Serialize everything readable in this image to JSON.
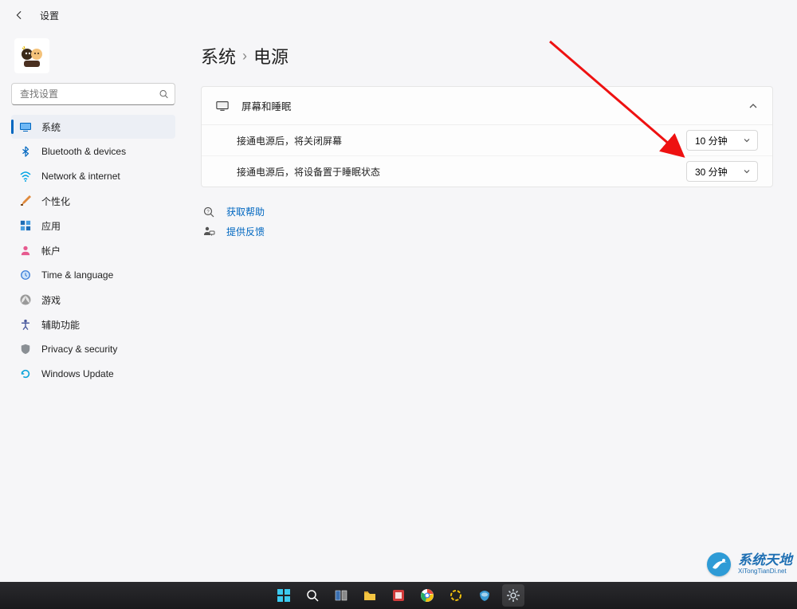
{
  "header": {
    "title": "设置"
  },
  "search": {
    "placeholder": "查找设置"
  },
  "nav": {
    "items": [
      {
        "label": "系统",
        "icon": "system",
        "color": "#0067c0"
      },
      {
        "label": "Bluetooth & devices",
        "icon": "bluetooth",
        "color": "#0067c0"
      },
      {
        "label": "Network & internet",
        "icon": "wifi",
        "color": "#00a4e4"
      },
      {
        "label": "个性化",
        "icon": "personalize",
        "color": "#e08a3c"
      },
      {
        "label": "应用",
        "icon": "apps",
        "color": "#1f6db5"
      },
      {
        "label": "帐户",
        "icon": "account",
        "color": "#e65a8f"
      },
      {
        "label": "Time & language",
        "icon": "time",
        "color": "#3b7dd8"
      },
      {
        "label": "游戏",
        "icon": "gaming",
        "color": "#7a7a7a"
      },
      {
        "label": "辅助功能",
        "icon": "accessibility",
        "color": "#4a5a9e"
      },
      {
        "label": "Privacy & security",
        "icon": "privacy",
        "color": "#8a8f94"
      },
      {
        "label": "Windows Update",
        "icon": "update",
        "color": "#0aa3d9"
      }
    ],
    "active_index": 0
  },
  "breadcrumb": {
    "parent": "系统",
    "current": "电源"
  },
  "card": {
    "title": "屏幕和睡眠",
    "rows": [
      {
        "label": "接通电源后，将关闭屏幕",
        "value": "10 分钟"
      },
      {
        "label": "接通电源后，将设备置于睡眠状态",
        "value": "30 分钟"
      }
    ]
  },
  "help": {
    "get_help": "获取帮助",
    "feedback": "提供反馈"
  },
  "watermark": {
    "main": "系统天地",
    "sub": "XiTongTianDi.net"
  }
}
